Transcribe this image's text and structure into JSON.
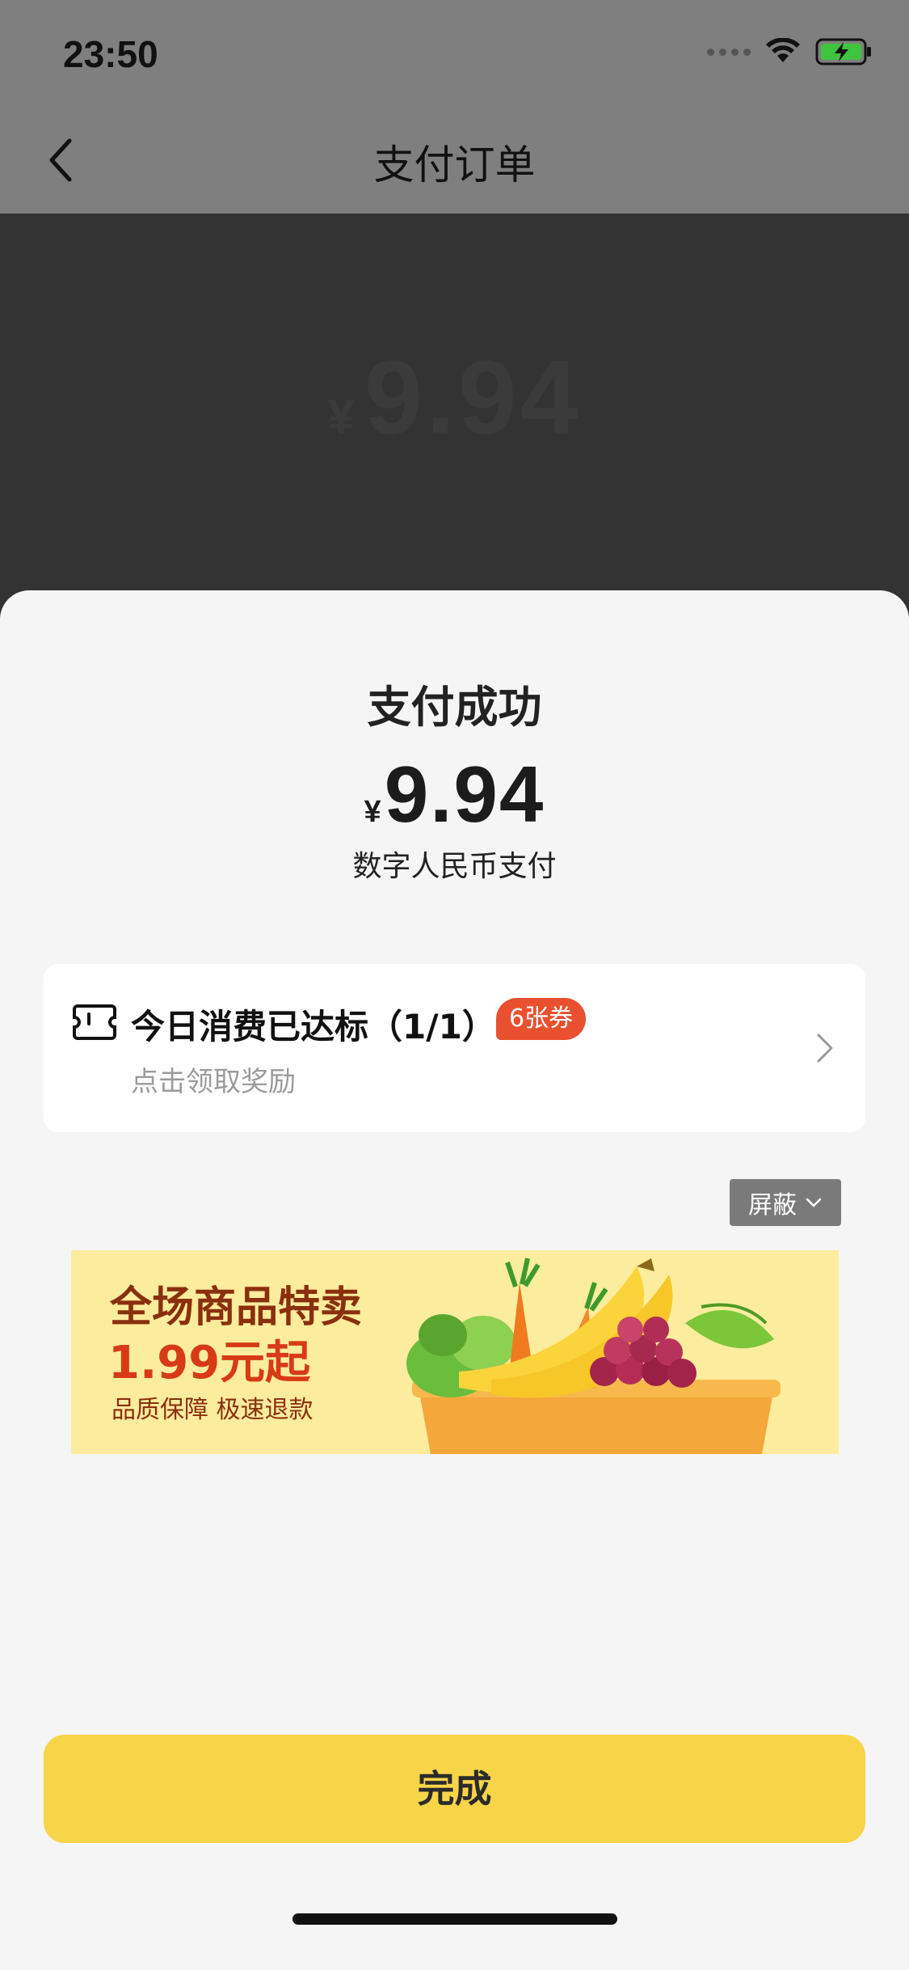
{
  "status_bar": {
    "time": "23:50"
  },
  "nav": {
    "title": "支付订单"
  },
  "background": {
    "amount_currency": "¥",
    "amount_value": "9.94"
  },
  "sheet": {
    "title": "支付成功",
    "amount_currency": "¥",
    "amount_value": "9.94",
    "payment_method": "数字人民币支付"
  },
  "reward": {
    "title": "今日消费已达标（1/1）",
    "badge": "6张券",
    "subtitle": "点击领取奖励"
  },
  "ad": {
    "block_label": "屏蔽",
    "headline": "全场商品特卖",
    "price_line": "1.99元起",
    "tagline": "品质保障 极速退款"
  },
  "actions": {
    "done_label": "完成"
  },
  "colors": {
    "primary_button": "#f7d448",
    "badge": "#e8502f",
    "ad_background": "#fbec9e"
  }
}
